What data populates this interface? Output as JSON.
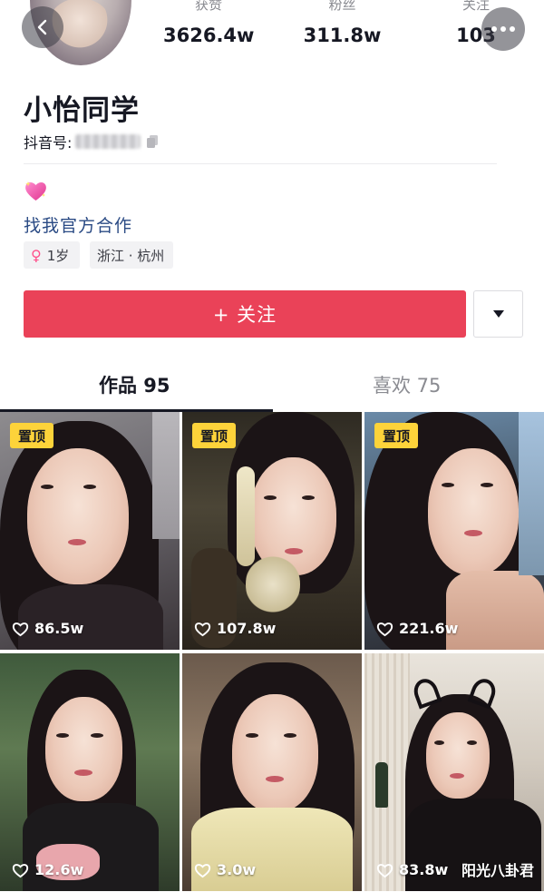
{
  "header": {
    "stats": [
      {
        "label": "获赞",
        "value": "3626.4w"
      },
      {
        "label": "粉丝",
        "value": "311.8w"
      },
      {
        "label": "关注",
        "value": "103"
      }
    ],
    "back_icon": "chevron-left-icon",
    "more_icon": "more-dots-icon"
  },
  "profile": {
    "nickname": "小怡同学",
    "douyin_id_label": "抖音号:",
    "bio_emoji": "sparkling-heart",
    "bio_link": "找我官方合作",
    "tags": {
      "age": "1岁",
      "location": "浙江 · 杭州"
    }
  },
  "actions": {
    "follow_label": "+ 关注"
  },
  "tabs": [
    {
      "label": "作品 95",
      "active": true
    },
    {
      "label": "喜欢 75",
      "active": false
    }
  ],
  "videos": [
    {
      "pinned": true,
      "pin_label": "置顶",
      "likes": "86.5w"
    },
    {
      "pinned": true,
      "pin_label": "置顶",
      "likes": "107.8w"
    },
    {
      "pinned": true,
      "pin_label": "置顶",
      "likes": "221.6w"
    },
    {
      "pinned": false,
      "likes": "12.6w"
    },
    {
      "pinned": false,
      "likes": "3.0w"
    },
    {
      "pinned": false,
      "likes": "83.8w"
    }
  ],
  "watermark": "阳光八卦君",
  "colors": {
    "accent": "#ea4258",
    "pin_badge": "#fdd33a",
    "link": "#2a4a84"
  }
}
